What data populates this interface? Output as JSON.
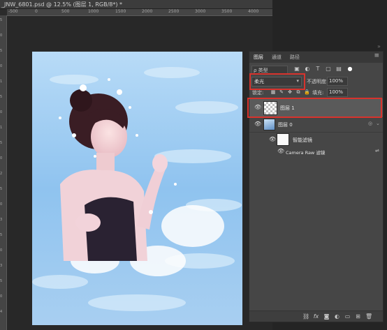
{
  "document": {
    "tab_title": "_JNW_6801.psd @ 12.5% (图层 1, RGB/8*) *",
    "ruler_top_ticks": [
      "-500",
      "0",
      "500",
      "1000",
      "1500",
      "2000",
      "2500",
      "3000",
      "3500",
      "4000"
    ],
    "ruler_left_ticks": [
      "5",
      "0",
      "5",
      "0",
      "1",
      "5",
      "0",
      "1",
      "5",
      "0",
      "2",
      "5",
      "0",
      "3",
      "5",
      "0",
      "3",
      "5",
      "0",
      "4"
    ]
  },
  "panel": {
    "tabs": [
      "图层",
      "通道",
      "路径"
    ],
    "active_tab": "图层",
    "filter": {
      "label": "ρ 类型",
      "icons": [
        "image-filter-icon",
        "adjustment-filter-icon",
        "type-filter-icon",
        "shape-filter-icon",
        "smart-object-filter-icon"
      ]
    },
    "blend_mode": "柔光",
    "opacity_label": "不透明度:",
    "opacity_value": "100%",
    "lock_label": "锁定:",
    "fill_label": "填充:",
    "fill_value": "100%",
    "layers": [
      {
        "name": "图层 1",
        "selected": true
      },
      {
        "name": "图层 0",
        "selected": false
      },
      {
        "name": "智能滤镜",
        "selected": false
      },
      {
        "name": "Camera Raw 滤镜",
        "selected": false
      }
    ]
  },
  "colors": {
    "highlight": "#d8332d",
    "panel_bg": "#464646",
    "selected_row": "#5a5a5a"
  }
}
